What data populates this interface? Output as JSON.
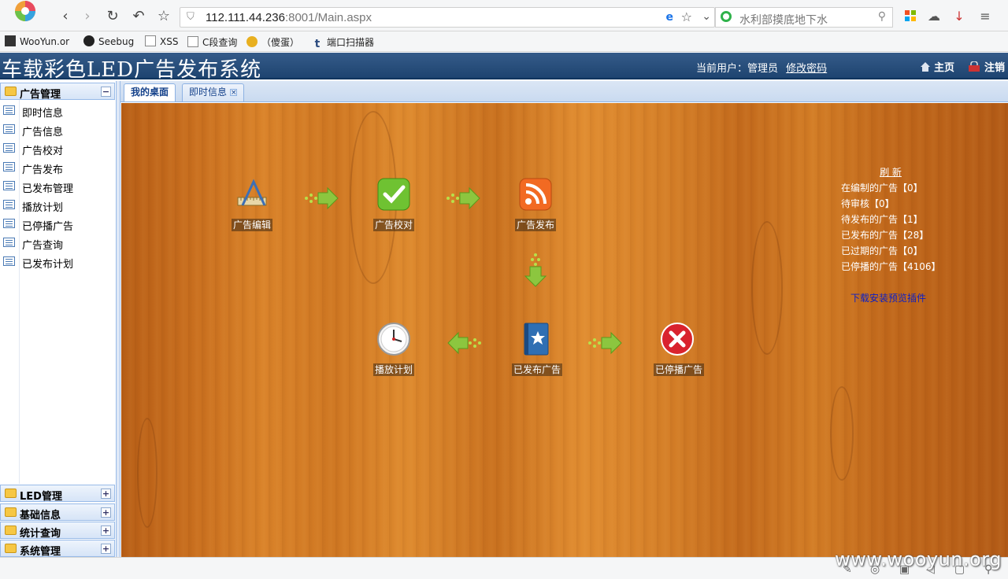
{
  "browser": {
    "url_host": "112.111.44.236",
    "url_rest": ":8001/Main.aspx",
    "search_text": "水利部摸底地下水",
    "bookmarks": [
      "WooYun.or",
      "Seebug",
      "XSS",
      "C段查询",
      "（傻蛋）",
      "端口扫描器"
    ]
  },
  "header": {
    "title": "车载彩色LED广告发布系统",
    "current_user_label": "当前用户：管理员",
    "change_password": "修改密码",
    "home": "主页",
    "logout": "注销"
  },
  "sidebar": {
    "panels": [
      {
        "label": "广告管理",
        "toggle": "−",
        "expanded": true
      },
      {
        "label": "LED管理",
        "toggle": "+"
      },
      {
        "label": "基础信息",
        "toggle": "+"
      },
      {
        "label": "统计查询",
        "toggle": "+"
      },
      {
        "label": "系统管理",
        "toggle": "+"
      }
    ],
    "items": [
      "即时信息",
      "广告信息",
      "广告校对",
      "广告发布",
      "已发布管理",
      "播放计划",
      "已停播广告",
      "广告查询",
      "已发布计划"
    ]
  },
  "tabs": [
    {
      "label": "我的桌面",
      "active": true
    },
    {
      "label": "即时信息",
      "active": false,
      "close": "×"
    }
  ],
  "desktop": {
    "flow": [
      {
        "label": "广告编辑",
        "icon": "ruler-triangle-icon"
      },
      {
        "label": "广告校对",
        "icon": "checkmark-icon"
      },
      {
        "label": "广告发布",
        "icon": "rss-icon"
      },
      {
        "label": "播放计划",
        "icon": "clock-icon"
      },
      {
        "label": "已发布广告",
        "icon": "book-star-icon"
      },
      {
        "label": "已停播广告",
        "icon": "stop-x-icon"
      }
    ],
    "stats": {
      "refresh": "刷 新",
      "lines": [
        "在编制的广告【0】",
        "待审核【0】",
        "待发布的广告【1】",
        "已发布的广告【28】",
        "已过期的广告【0】",
        "已停播的广告【4106】"
      ],
      "download": "下载安装预览插件"
    }
  },
  "statusbar": {
    "watermark": "www.wooyun.org"
  },
  "colors": {
    "header_bg": "#1e4470",
    "wood": "#d98229",
    "link_blue": "#0a1fc6"
  }
}
